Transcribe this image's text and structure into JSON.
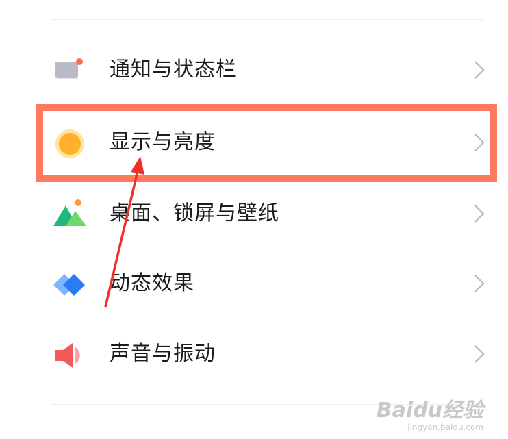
{
  "settings_list": {
    "items": [
      {
        "label": "通知与状态栏",
        "icon": "notification-icon"
      },
      {
        "label": "显示与亮度",
        "icon": "brightness-icon"
      },
      {
        "label": "桌面、锁屏与壁纸",
        "icon": "wallpaper-icon"
      },
      {
        "label": "动态效果",
        "icon": "animation-icon"
      },
      {
        "label": "声音与振动",
        "icon": "sound-icon"
      }
    ]
  },
  "annotation": {
    "highlight_color": "#ff7a5e",
    "arrow_color": "#f0302a",
    "highlighted_item": "显示与亮度"
  },
  "watermark": {
    "logo": "Baidu经验",
    "url": "jingyan.baidu.com"
  }
}
